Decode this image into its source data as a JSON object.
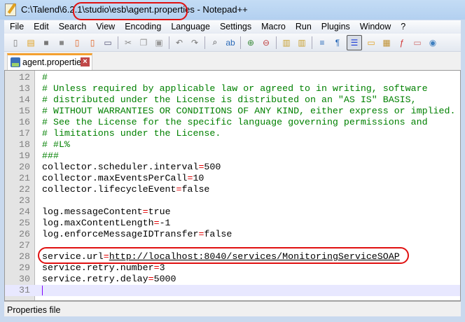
{
  "window": {
    "title": "C:\\Talend\\6.2.1\\studio\\esb\\agent.properties - Notepad++"
  },
  "menu": [
    "File",
    "Edit",
    "Search",
    "View",
    "Encoding",
    "Language",
    "Settings",
    "Macro",
    "Run",
    "Plugins",
    "Window",
    "?"
  ],
  "toolbar": [
    {
      "icon": "new-file-icon",
      "glyph": "▯",
      "color": "#7a7a7a"
    },
    {
      "icon": "open-file-icon",
      "glyph": "▤",
      "color": "#e0a020"
    },
    {
      "icon": "save-icon",
      "glyph": "■",
      "color": "#777"
    },
    {
      "icon": "save-all-icon",
      "glyph": "■",
      "color": "#888"
    },
    {
      "icon": "close-file-icon",
      "glyph": "▯",
      "color": "#e06020"
    },
    {
      "icon": "close-all-icon",
      "glyph": "▯",
      "color": "#e06020"
    },
    {
      "icon": "print-icon",
      "glyph": "▭",
      "color": "#557"
    },
    {
      "sep": true
    },
    {
      "icon": "cut-icon",
      "glyph": "✂",
      "color": "#888"
    },
    {
      "icon": "copy-icon",
      "glyph": "❐",
      "color": "#999"
    },
    {
      "icon": "paste-icon",
      "glyph": "▣",
      "color": "#999"
    },
    {
      "sep": true
    },
    {
      "icon": "undo-icon",
      "glyph": "↶",
      "color": "#777"
    },
    {
      "icon": "redo-icon",
      "glyph": "↷",
      "color": "#777"
    },
    {
      "sep": true
    },
    {
      "icon": "find-icon",
      "glyph": "⌕",
      "color": "#333"
    },
    {
      "icon": "replace-icon",
      "glyph": "ab",
      "color": "#2a6ab8"
    },
    {
      "sep": true
    },
    {
      "icon": "zoom-in-icon",
      "glyph": "⊕",
      "color": "#3a8a3a"
    },
    {
      "icon": "zoom-out-icon",
      "glyph": "⊖",
      "color": "#c04040"
    },
    {
      "sep": true
    },
    {
      "icon": "sync-vertical-icon",
      "glyph": "▥",
      "color": "#c8a030"
    },
    {
      "icon": "sync-horizontal-icon",
      "glyph": "▥",
      "color": "#c8a030"
    },
    {
      "sep": true
    },
    {
      "icon": "word-wrap-icon",
      "glyph": "≡",
      "color": "#2a6ab8"
    },
    {
      "icon": "show-all-chars-icon",
      "glyph": "¶",
      "color": "#2a6ab8"
    },
    {
      "icon": "indent-guide-icon",
      "glyph": "☰",
      "color": "#1a3ad8",
      "active": true
    },
    {
      "icon": "user-language-icon",
      "glyph": "▭",
      "color": "#e0a020"
    },
    {
      "icon": "document-map-icon",
      "glyph": "▦",
      "color": "#c09030"
    },
    {
      "icon": "function-list-icon",
      "glyph": "ƒ",
      "color": "#d03030"
    },
    {
      "icon": "folder-workspace-icon",
      "glyph": "▭",
      "color": "#d07070"
    },
    {
      "icon": "monitoring-icon",
      "glyph": "◉",
      "color": "#4080c0"
    }
  ],
  "tab": {
    "label": "agent.properties"
  },
  "editor": {
    "lines": [
      {
        "n": "12",
        "comment": "#"
      },
      {
        "n": "13",
        "comment": "# Unless required by applicable law or agreed to in writing, software"
      },
      {
        "n": "14",
        "comment": "# distributed under the License is distributed on an \"AS IS\" BASIS,"
      },
      {
        "n": "15",
        "comment": "# WITHOUT WARRANTIES OR CONDITIONS OF ANY KIND, either express or implied."
      },
      {
        "n": "16",
        "comment": "# See the License for the specific language governing permissions and"
      },
      {
        "n": "17",
        "comment": "# limitations under the License."
      },
      {
        "n": "18",
        "comment": "# #L%"
      },
      {
        "n": "19",
        "comment": "###"
      },
      {
        "n": "20",
        "key": "collector.scheduler.interval",
        "value": "500"
      },
      {
        "n": "21",
        "key": "collector.maxEventsPerCall",
        "value": "10"
      },
      {
        "n": "22",
        "key": "collector.lifecycleEvent",
        "value": "false"
      },
      {
        "n": "23"
      },
      {
        "n": "24",
        "key": "log.messageContent",
        "value": "true"
      },
      {
        "n": "25",
        "key": "log.maxContentLength",
        "value": "-1"
      },
      {
        "n": "26",
        "key": "log.enforceMessageIDTransfer",
        "value": "false"
      },
      {
        "n": "27"
      },
      {
        "n": "28",
        "key": "service.url",
        "value": "http://localhost:8040/services/MonitoringServiceSOAP",
        "link": true
      },
      {
        "n": "29",
        "key": "service.retry.number",
        "value": "3"
      },
      {
        "n": "30",
        "key": "service.retry.delay",
        "value": "5000"
      },
      {
        "n": "31",
        "current": true
      }
    ]
  },
  "status": {
    "file_type": "Properties file"
  }
}
